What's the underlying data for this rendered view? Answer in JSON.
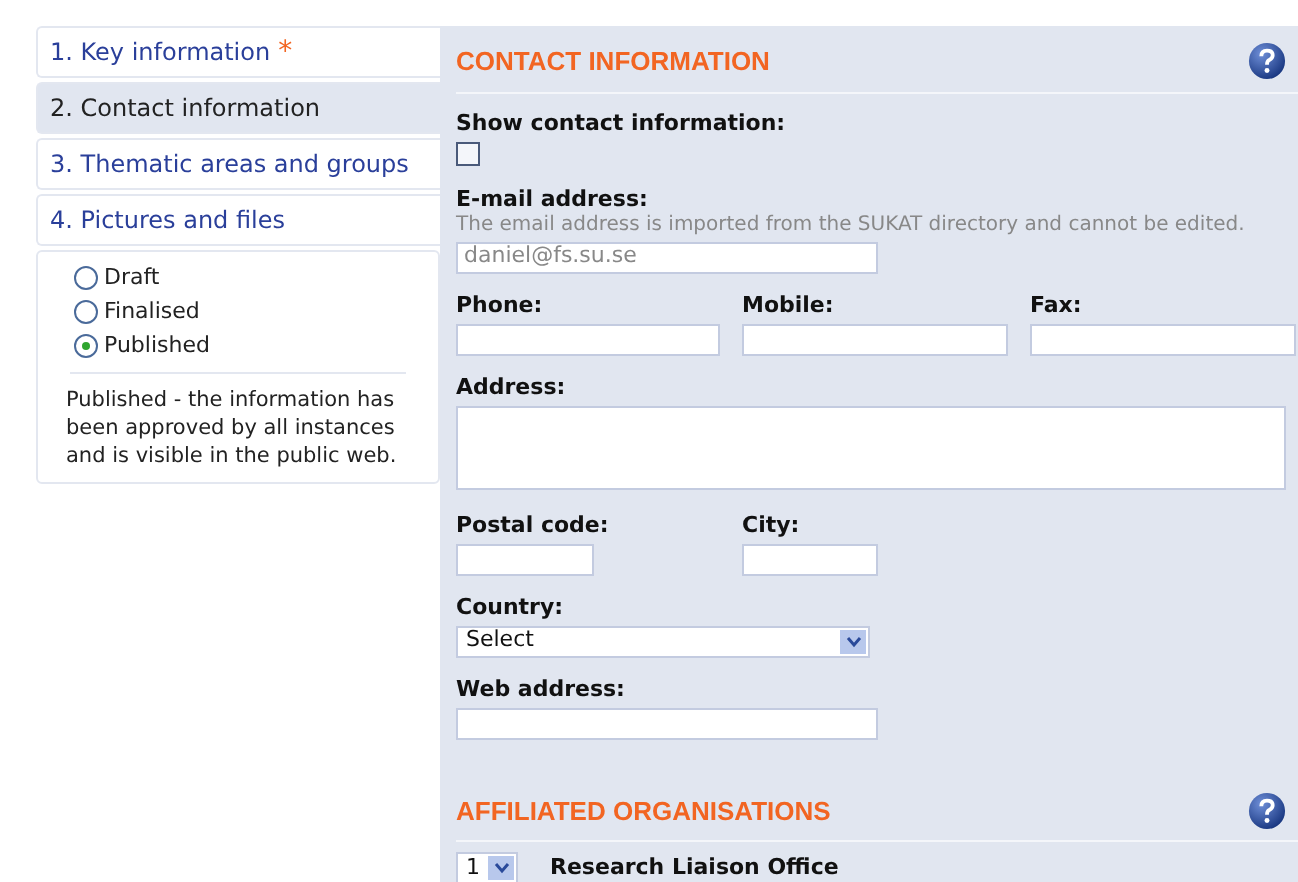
{
  "steps": [
    {
      "label": "1. Key information",
      "selected": false,
      "required_mark": "*"
    },
    {
      "label": "2. Contact information",
      "selected": true
    },
    {
      "label": "3. Thematic areas and groups",
      "selected": false
    },
    {
      "label": "4. Pictures and files",
      "selected": false
    }
  ],
  "status": {
    "options": [
      {
        "label": "Draft",
        "selected": false
      },
      {
        "label": "Finalised",
        "selected": false
      },
      {
        "label": "Published",
        "selected": true
      }
    ],
    "description": "Published - the information has been approved by all instances and is visible in the public web."
  },
  "contact": {
    "title": "CONTACT INFORMATION",
    "show": {
      "label": "Show contact information:",
      "checked": false
    },
    "email": {
      "label": "E-mail address:",
      "hint": "The email address is imported from the SUKAT directory and cannot be edited.",
      "value": "daniel@fs.su.se"
    },
    "phone": {
      "label": "Phone:"
    },
    "mobile": {
      "label": "Mobile:"
    },
    "fax": {
      "label": "Fax:"
    },
    "address": {
      "label": "Address:"
    },
    "postal_code": {
      "label": "Postal code:"
    },
    "city": {
      "label": "City:"
    },
    "country": {
      "label": "Country:",
      "value": "Select"
    },
    "web": {
      "label": "Web address:"
    }
  },
  "affiliated": {
    "title": "AFFILIATED ORGANISATIONS",
    "rows": [
      {
        "order": "1",
        "name": "Research Liaison Office"
      }
    ]
  }
}
